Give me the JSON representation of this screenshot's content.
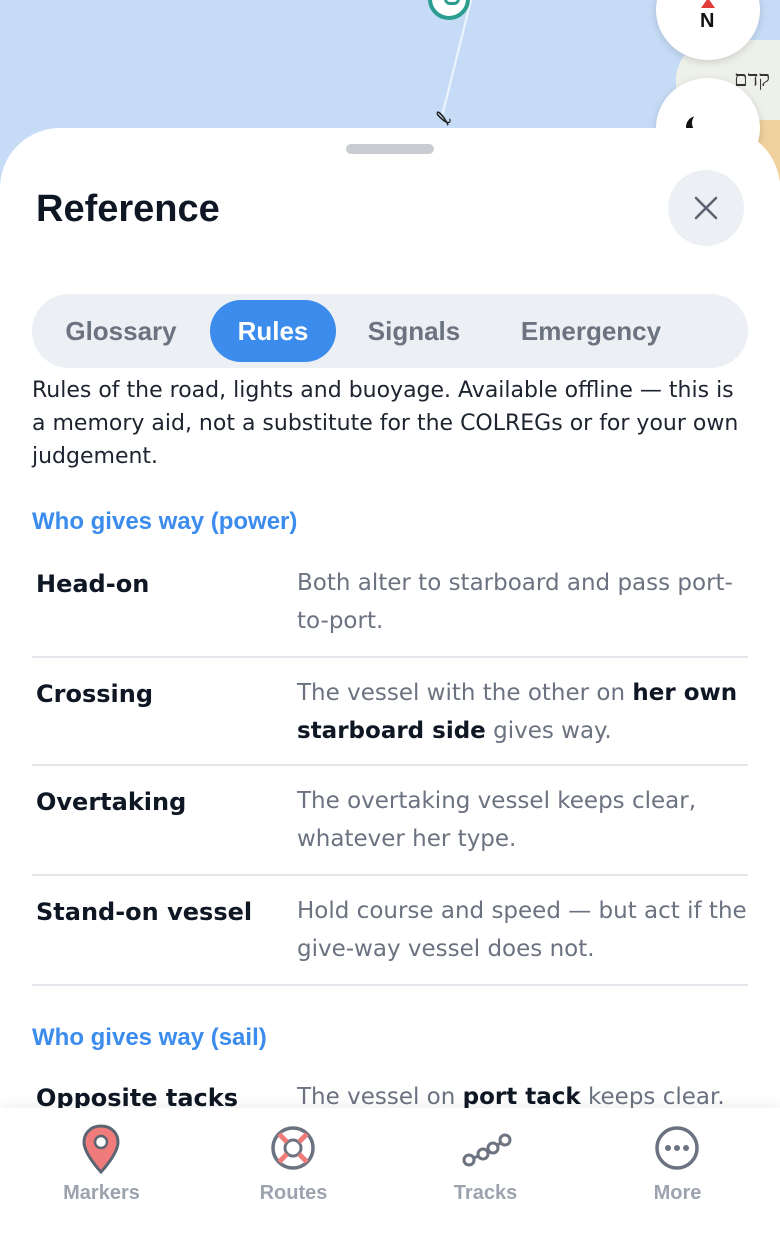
{
  "map": {
    "compass_label": "N",
    "place_label": "קדם"
  },
  "sheet": {
    "title": "Reference",
    "tabs": [
      {
        "label": "Glossary",
        "active": false
      },
      {
        "label": "Rules",
        "active": true
      },
      {
        "label": "Signals",
        "active": false
      },
      {
        "label": "Emergency",
        "active": false
      }
    ],
    "intro": "Rules of the road, lights and buoyage. Available offline — this is a memory aid, not a substitute for the COLREGs or for your own judgement.",
    "sections": [
      {
        "heading": "Who gives way (power)",
        "rules": [
          {
            "term": "Head-on",
            "desc": "Both alter to starboard and pass port-to-port."
          },
          {
            "term": "Crossing",
            "desc_before": "The vessel with the other on ",
            "desc_bold": "her own starboard side",
            "desc_after": " gives way."
          },
          {
            "term": "Overtaking",
            "desc": "The overtaking vessel keeps clear, whatever her type."
          },
          {
            "term": "Stand-on vessel",
            "desc": "Hold course and speed — but act if the give-way vessel does not."
          }
        ]
      },
      {
        "heading": "Who gives way (sail)",
        "rules": [
          {
            "term": "Opposite tacks",
            "desc_before": "The vessel on ",
            "desc_bold": "port tack",
            "desc_after": " keeps clear."
          }
        ]
      }
    ]
  },
  "bottom_nav": [
    {
      "label": "Markers",
      "icon": "map-pin-icon",
      "color": "#ef7b7b"
    },
    {
      "label": "Routes",
      "icon": "lifebuoy-icon",
      "color": "#6b7280"
    },
    {
      "label": "Tracks",
      "icon": "track-nodes-icon",
      "color": "#6b7280"
    },
    {
      "label": "More",
      "icon": "more-dots-icon",
      "color": "#6b7280"
    }
  ],
  "colors": {
    "accent": "#3b8ced",
    "heading": "#0f1724",
    "muted": "#6b7280"
  }
}
